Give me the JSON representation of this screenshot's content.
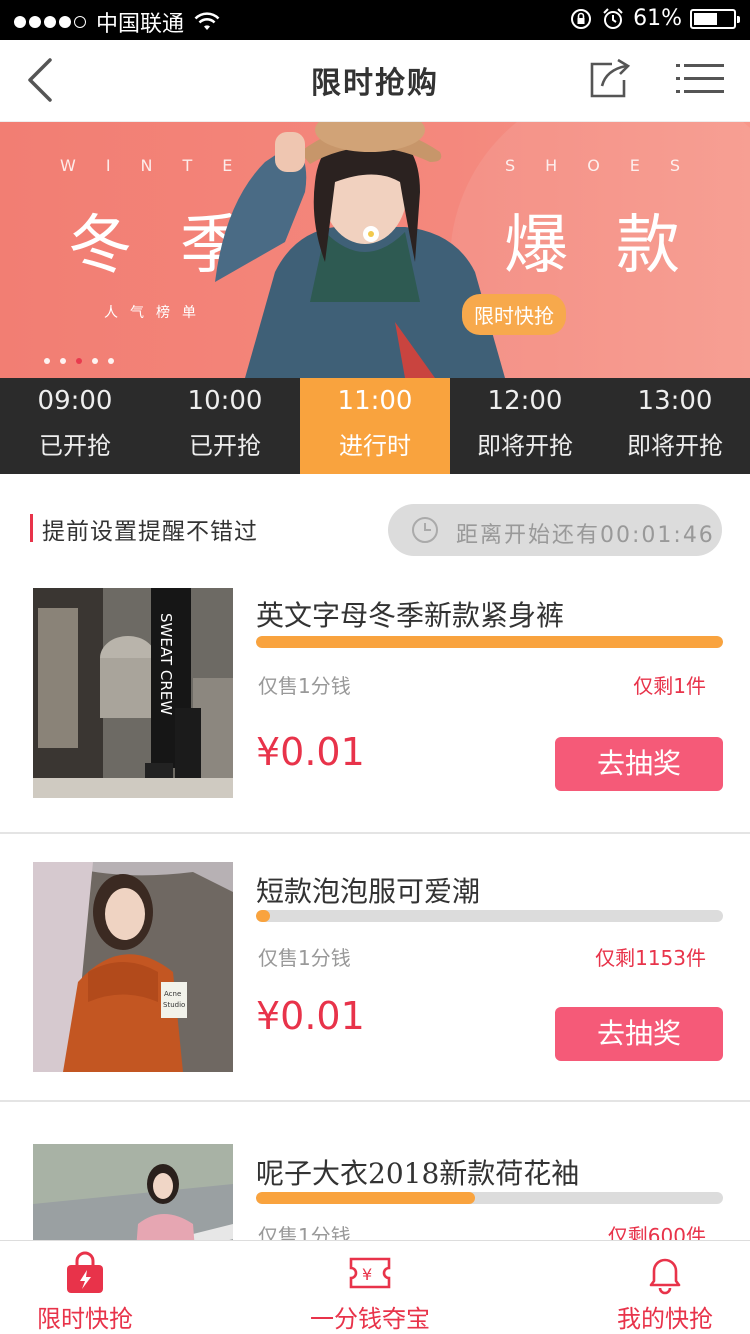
{
  "status_bar": {
    "carrier": "中国联通",
    "battery": "61%",
    "battery_level": 0.61
  },
  "navbar": {
    "title": "限时抢购"
  },
  "banner": {
    "en_left": "WINTE",
    "en_right": "SHOES",
    "big_left": "冬季",
    "big_right": "爆款",
    "sub": "人气榜单",
    "badge": "限时快抢",
    "pager_count": 5,
    "pager_active": 2
  },
  "time_tabs": [
    {
      "time": "09:00",
      "status": "已开抢"
    },
    {
      "time": "10:00",
      "status": "已开抢"
    },
    {
      "time": "11:00",
      "status": "进行时",
      "active": true
    },
    {
      "time": "12:00",
      "status": "即将开抢"
    },
    {
      "time": "13:00",
      "status": "即将开抢"
    }
  ],
  "reminder": {
    "text": "提前设置提醒不错过",
    "countdown": "距离开始还有00:01:46"
  },
  "products": [
    {
      "title": "英文字母冬季新款紧身裤",
      "progress": 1.0,
      "note": "仅售1分钱",
      "remain": "仅剩1件",
      "price": "¥0.01",
      "button": "去抽奖"
    },
    {
      "title": "短款泡泡服可爱潮",
      "progress": 0.03,
      "note": "仅售1分钱",
      "remain": "仅剩1153件",
      "price": "¥0.01",
      "button": "去抽奖"
    },
    {
      "title": "呢子大衣2018新款荷花袖",
      "progress": 0.47,
      "note": "仅售1分钱",
      "remain": "仅剩600件",
      "price": "",
      "button": ""
    }
  ],
  "bottom_nav": [
    {
      "label": "限时快抢",
      "icon": "shopping-bag-icon"
    },
    {
      "label": "一分钱夺宝",
      "icon": "ticket-icon"
    },
    {
      "label": "我的快抢",
      "icon": "bell-icon"
    }
  ],
  "colors": {
    "accent": "#e8334a",
    "orange": "#f9a33e",
    "button": "#f55a78",
    "banner": "#f27e73"
  }
}
